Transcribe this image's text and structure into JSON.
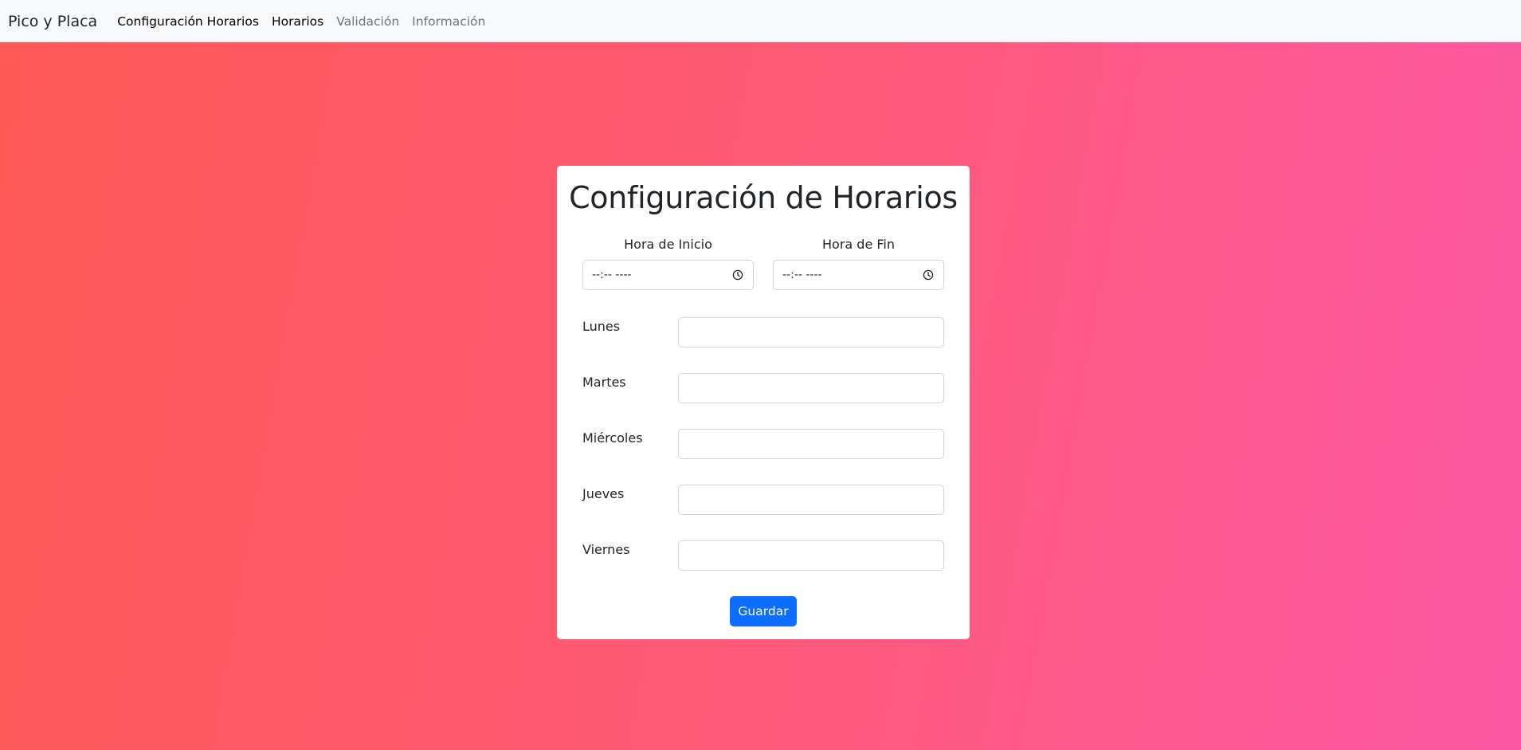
{
  "navbar": {
    "brand": "Pico y Placa",
    "links": [
      {
        "label": "Configuración Horarios"
      },
      {
        "label": "Horarios"
      },
      {
        "label": "Validación"
      },
      {
        "label": "Información"
      }
    ]
  },
  "card": {
    "title": "Configuración de Horarios",
    "start_time": {
      "label": "Hora de Inicio",
      "placeholder": "--:-- ----"
    },
    "end_time": {
      "label": "Hora de Fin",
      "placeholder": "--:-- ----"
    },
    "days": [
      {
        "label": "Lunes",
        "value": ""
      },
      {
        "label": "Martes",
        "value": ""
      },
      {
        "label": "Miércoles",
        "value": ""
      },
      {
        "label": "Jueves",
        "value": ""
      },
      {
        "label": "Viernes",
        "value": ""
      }
    ],
    "save_label": "Guardar"
  },
  "colors": {
    "navbar_bg": "#f8f9fa",
    "gradient_start": "#ff5a57",
    "gradient_end": "#fb58a3",
    "primary": "#0d6efd",
    "muted_link": "#6c757d"
  },
  "icons": {
    "time_picker": "clock-icon"
  }
}
